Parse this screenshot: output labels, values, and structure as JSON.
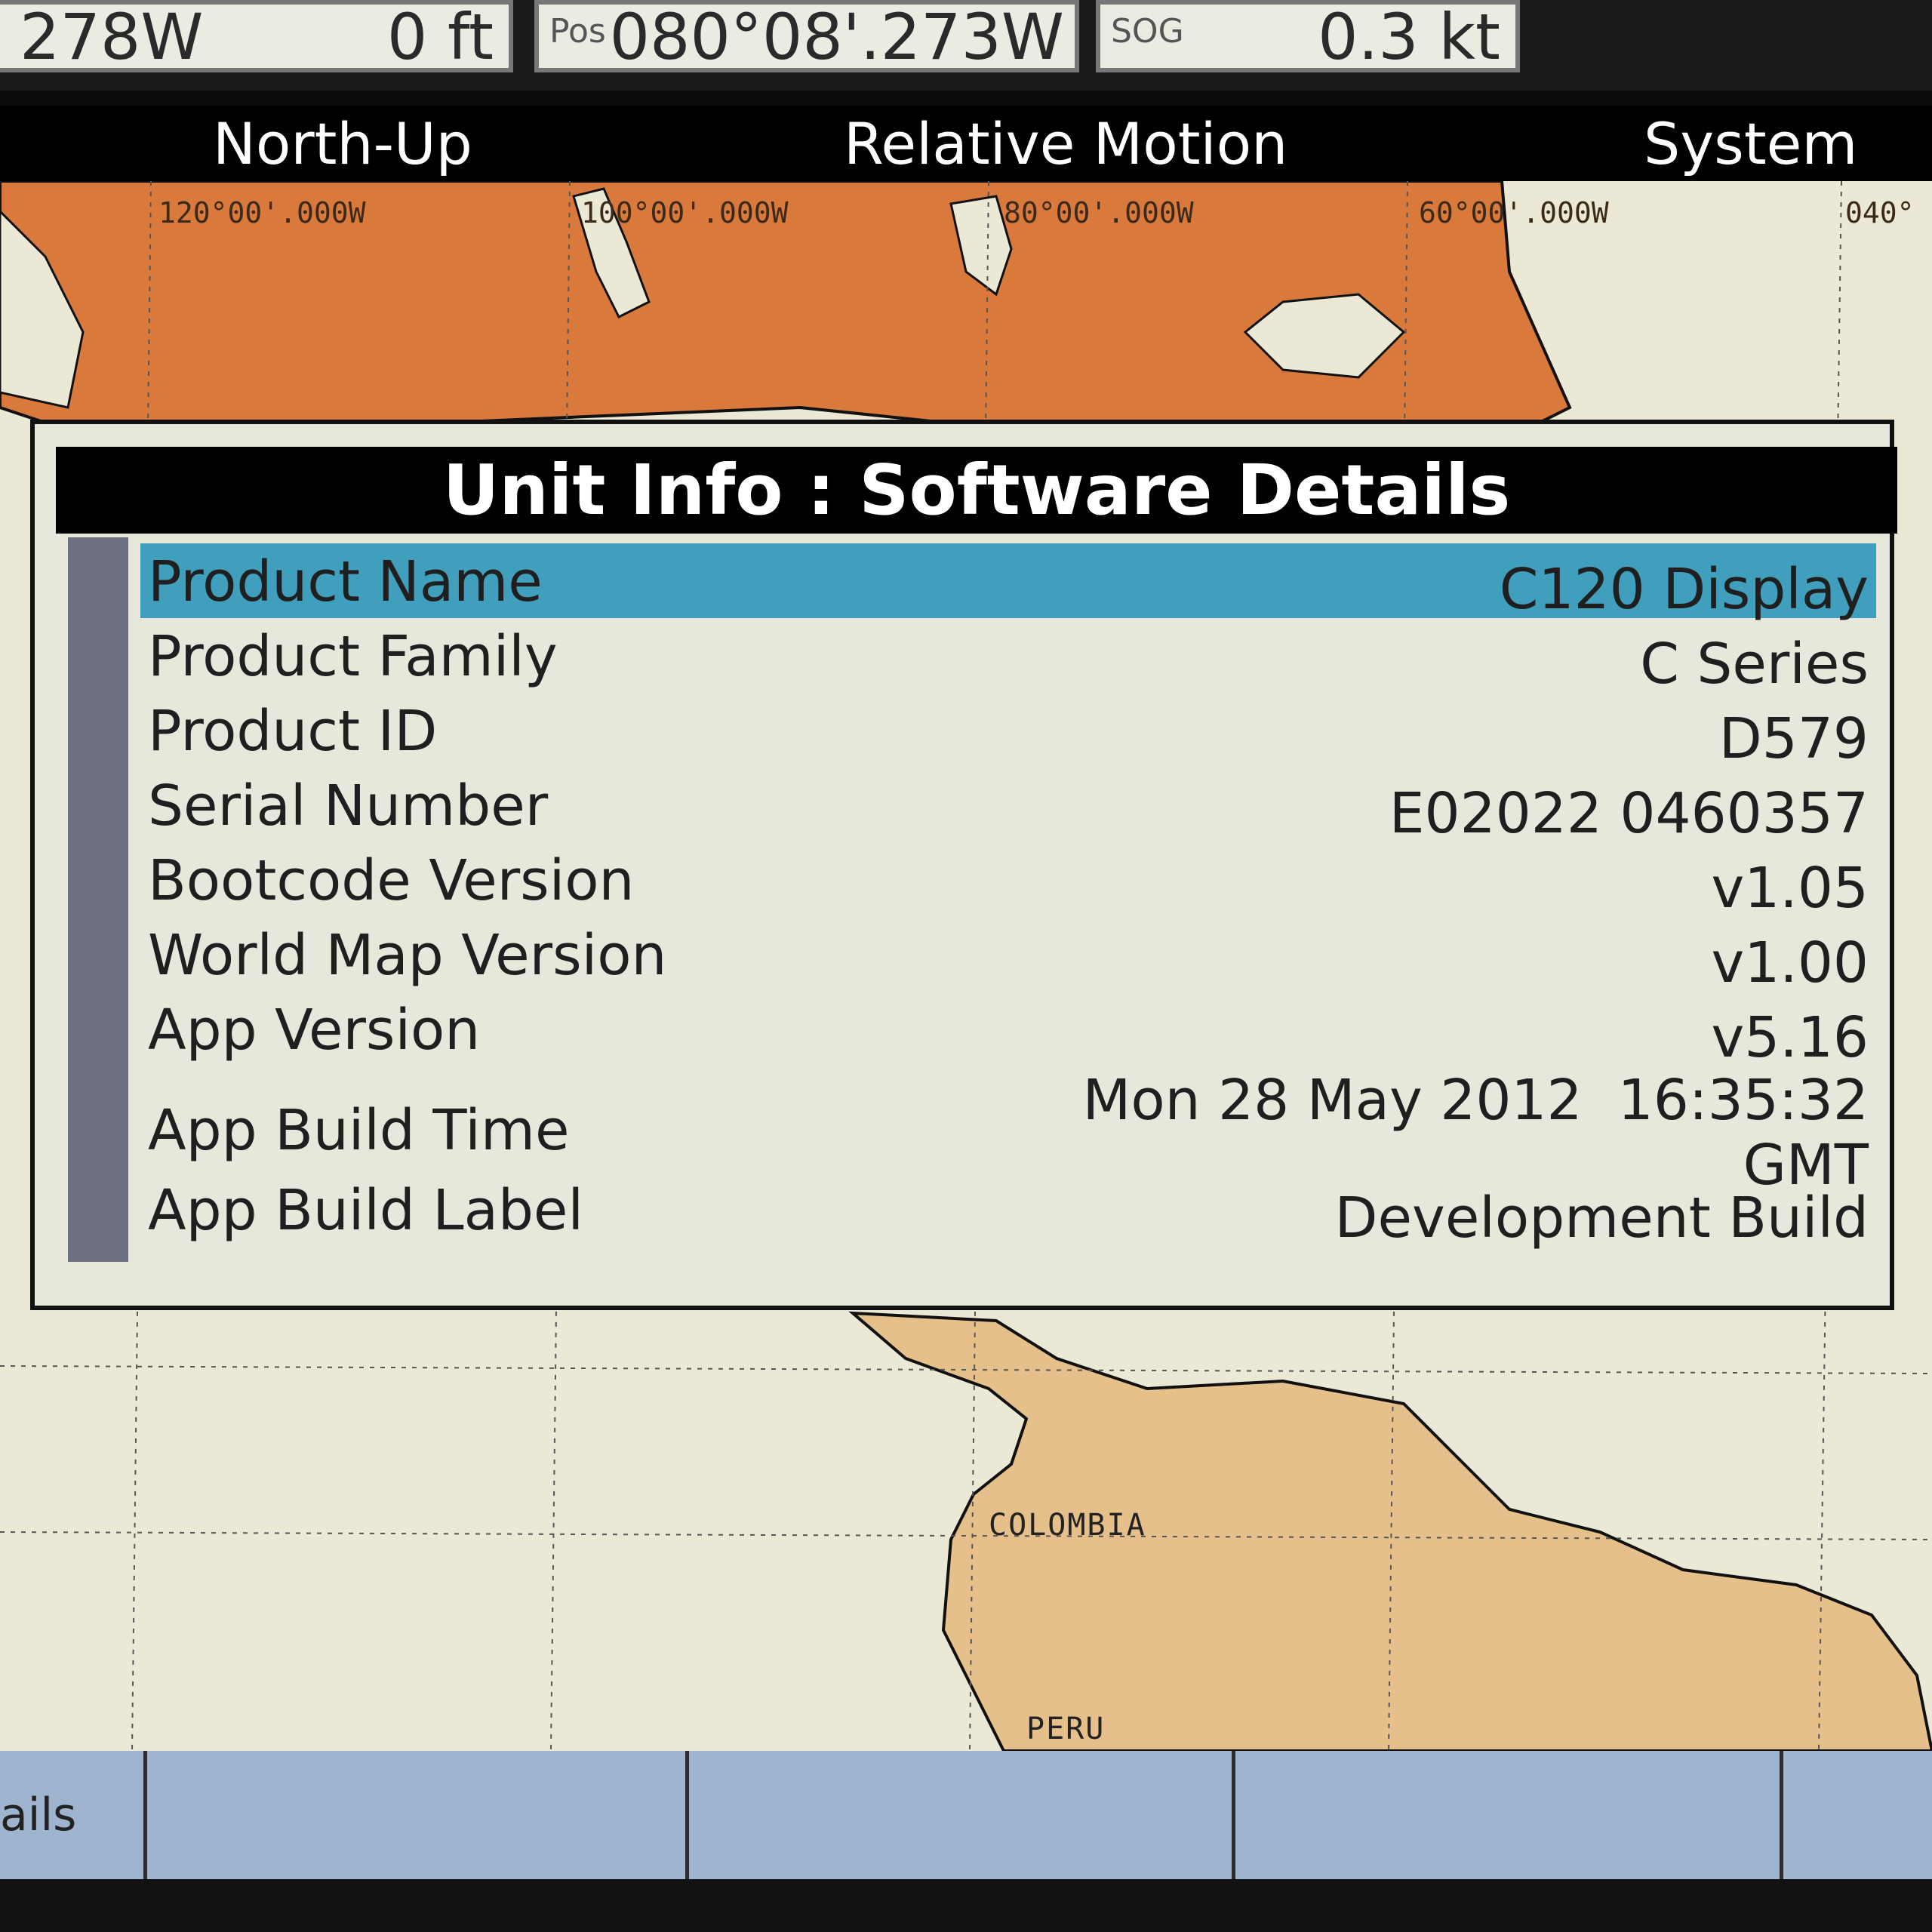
{
  "databar": {
    "cell1_value": "278W",
    "cell2_value": "0 ft",
    "pos_label": "Pos",
    "pos_value": "080°08'.273W",
    "sog_label": "SOG",
    "sog_value": "0.3 kt"
  },
  "modebar": {
    "orientation": "North-Up",
    "motion": "Relative Motion",
    "system": "System"
  },
  "chart": {
    "lon_labels": [
      "120°00'.000W",
      "100°00'.000W",
      "80°00'.000W",
      "60°00'.000W",
      "040°"
    ],
    "countries": [
      "COLOMBIA",
      "PERU"
    ],
    "colors": {
      "land_north": "#d97a3c",
      "land_south": "#e6c08a",
      "sea": "#ece8d6"
    }
  },
  "dialog": {
    "title": "Unit Info : Software Details",
    "rows": [
      {
        "label": "Product Name",
        "value": "C120 Display",
        "selected": true
      },
      {
        "label": "Product Family",
        "value": "C Series"
      },
      {
        "label": "Product ID",
        "value": "D579"
      },
      {
        "label": "Serial Number",
        "value": "E02022 0460357"
      },
      {
        "label": "Bootcode Version",
        "value": "v1.05"
      },
      {
        "label": "World Map Version",
        "value": "v1.00"
      },
      {
        "label": "App Version",
        "value": "v5.16"
      },
      {
        "label": "App Build Time",
        "value": "Mon 28 May 2012  16:35:32",
        "value2": "GMT"
      },
      {
        "label": "App Build Label",
        "value": "Development Build"
      }
    ],
    "selection_color": "#3f9fbd"
  },
  "softkeys": [
    {
      "label": "ails"
    },
    {
      "label": ""
    },
    {
      "label": ""
    },
    {
      "label": ""
    }
  ]
}
